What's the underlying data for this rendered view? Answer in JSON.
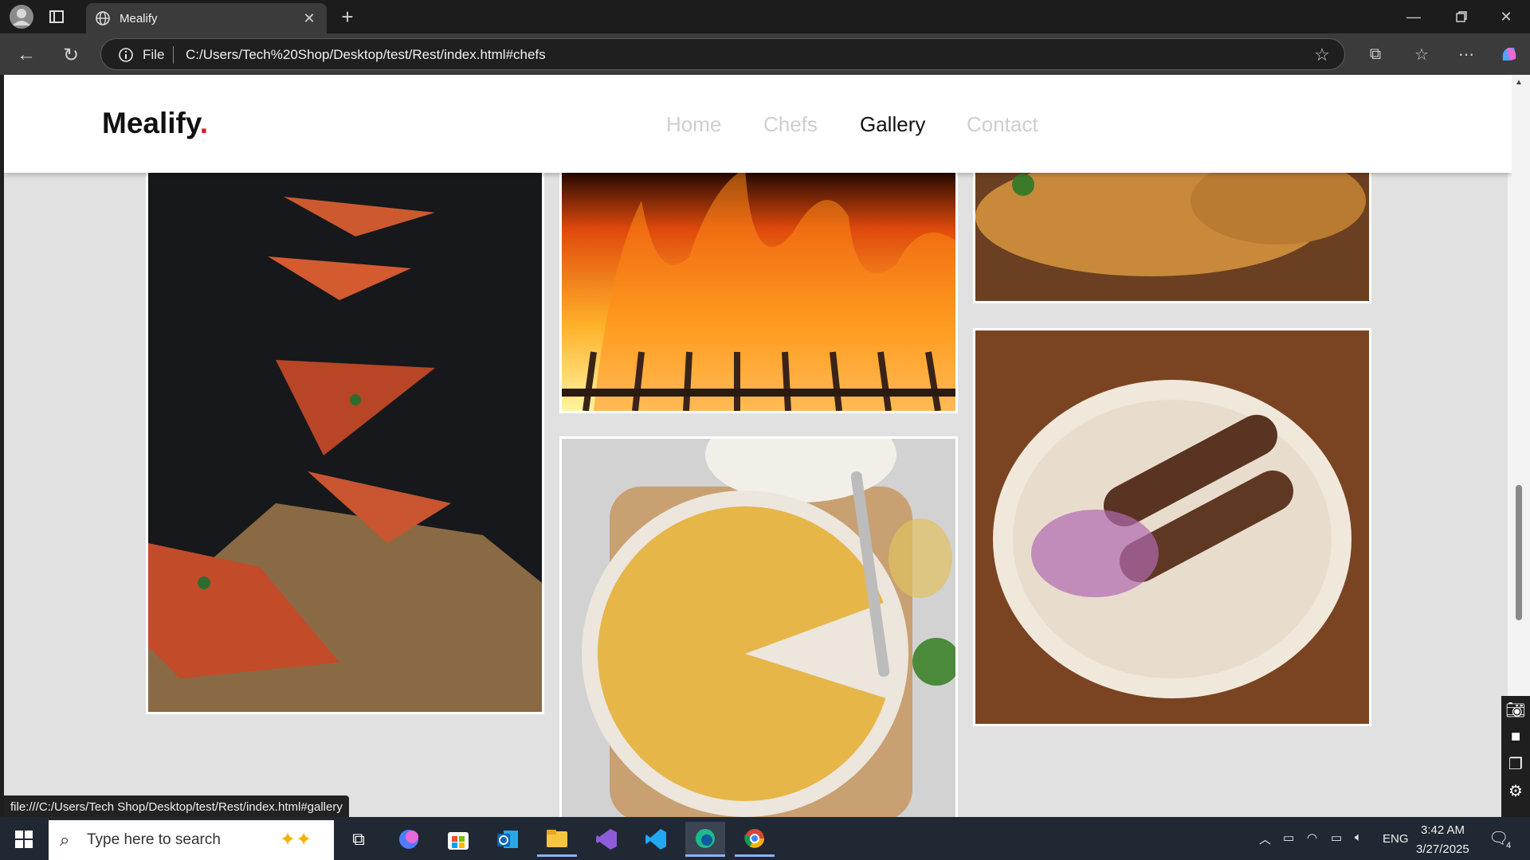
{
  "browser": {
    "tab_title": "Mealify",
    "address_prefix": "File",
    "url": "C:/Users/Tech%20Shop/Desktop/test/Rest/index.html#chefs",
    "status_url": "file:///C:/Users/Tech Shop/Desktop/test/Rest/index.html#gallery"
  },
  "site": {
    "logo_text": "Mealify",
    "logo_dot": ".",
    "nav": [
      {
        "label": "Home"
      },
      {
        "label": "Chefs"
      },
      {
        "label": "Gallery"
      },
      {
        "label": "Contact"
      }
    ],
    "active_nav": "Gallery",
    "accent_color": "#d81b1b"
  },
  "gallery": [
    {
      "name": "pizza-slices-image"
    },
    {
      "name": "grill-flames-image"
    },
    {
      "name": "fried-chicken-image"
    },
    {
      "name": "kebab-plate-image"
    },
    {
      "name": "omelette-image"
    }
  ],
  "taskbar": {
    "search_placeholder": "Type here to search",
    "language": "ENG",
    "time": "3:42 AM",
    "date": "3/27/2025",
    "notification_count": "4"
  }
}
